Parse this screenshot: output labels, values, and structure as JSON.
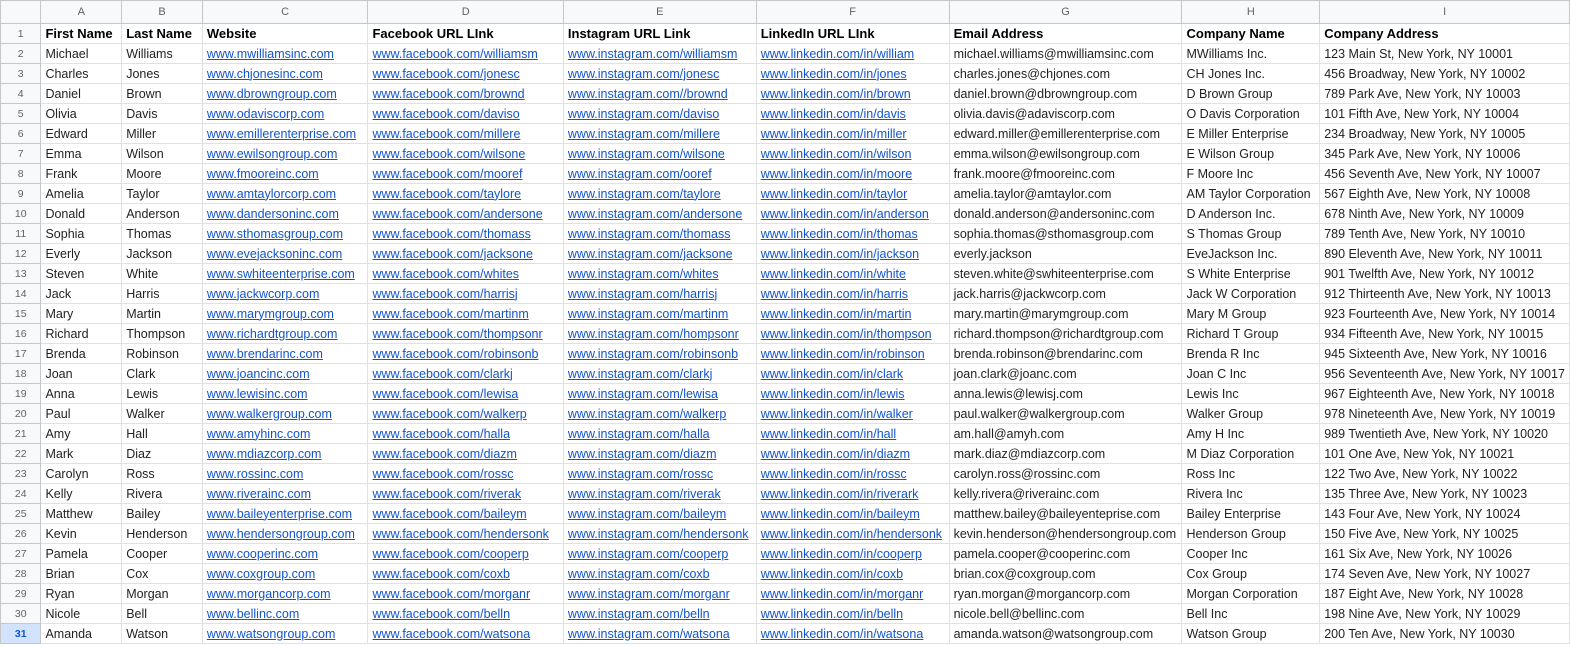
{
  "column_letters": [
    "A",
    "B",
    "C",
    "D",
    "E",
    "F",
    "G",
    "H",
    "I"
  ],
  "header_row": [
    "First Name",
    "Last Name",
    "Website",
    "Facebook URL LInk",
    "Instagram URL Link",
    "LinkedIn URL LInk",
    "Email Address",
    "Company Name",
    "Company Address"
  ],
  "rows": [
    [
      "Michael",
      "Williams",
      "www.mwilliamsinc.com",
      "www.facebook.com/williamsm",
      "www.instagram.com/williamsm",
      "www.linkedin.com/in/william",
      "michael.williams@mwilliamsinc.com",
      "MWilliams Inc.",
      "123 Main St, New York, NY 10001"
    ],
    [
      "Charles",
      "Jones",
      "www.chjonesinc.com",
      "www.facebook.com/jonesc",
      "www.instagram.com/jonesc",
      "www.linkedin.com/in/jones",
      "charles.jones@chjones.com",
      "CH Jones Inc.",
      "456 Broadway, New York, NY 10002"
    ],
    [
      "Daniel",
      "Brown",
      "www.dbrowngroup.com",
      "www.facebook.com/brownd",
      "www.instagram.com//brownd",
      "www.linkedin.com/in/brown",
      "daniel.brown@dbrowngroup.com",
      "D Brown Group",
      "789 Park Ave, New York, NY 10003"
    ],
    [
      "Olivia",
      "Davis",
      "www.odaviscorp.com",
      "www.facebook.com/daviso",
      "www.instagram.com/daviso",
      "www.linkedin.com/in/davis",
      "olivia.davis@adaviscorp.com",
      "O Davis Corporation",
      "101 Fifth Ave, New York, NY 10004"
    ],
    [
      "Edward",
      "Miller",
      "www.emillerenterprise.com",
      "www.facebook.com/millere",
      "www.instagram.com/millere",
      "www.linkedin.com/in/miller",
      "edward.miller@emillerenterprise.com",
      "E Miller Enterprise",
      "234 Broadway, New York, NY 10005"
    ],
    [
      "Emma",
      "Wilson",
      "www.ewilsongroup.com",
      "www.facebook.com/wilsone",
      "www.instagram.com/wilsone",
      "www.linkedin.com/in/wilson",
      "emma.wilson@ewilsongroup.com",
      "E Wilson Group",
      "345 Park Ave, New York, NY 10006"
    ],
    [
      "Frank",
      "Moore",
      "www.fmooreinc.com",
      "www.facebook.com/mooref",
      "www.instagram.com/ooref",
      "www.linkedin.com/in/moore",
      "frank.moore@fmooreinc.com",
      "F Moore Inc",
      "456 Seventh Ave, New York, NY 10007"
    ],
    [
      "Amelia",
      "Taylor",
      "www.amtaylorcorp.com",
      "www.facebook.com/taylore",
      "www.instagram.com/taylore",
      "www.linkedin.com/in/taylor",
      "amelia.taylor@amtaylor.com",
      "AM Taylor Corporation",
      "567 Eighth Ave, New York, NY 10008"
    ],
    [
      "Donald",
      "Anderson",
      "www.dandersoninc.com",
      "www.facebook.com/andersone",
      "www.instagram.com/andersone",
      "www.linkedin.com/in/anderson",
      "donald.anderson@andersoninc.com",
      "D Anderson Inc.",
      "678 Ninth Ave, New York, NY 10009"
    ],
    [
      "Sophia",
      "Thomas",
      "www.sthomasgroup.com",
      "www.facebook.com/thomass",
      "www.instagram.com/thomass",
      "www.linkedin.com/in/thomas",
      "sophia.thomas@sthomasgroup.com",
      "S Thomas  Group",
      "789 Tenth Ave, New York, NY 10010"
    ],
    [
      "Everly",
      "Jackson",
      "www.evejacksoninc.com",
      "www.facebook.com/jacksone",
      "www.instagram.com/jacksone",
      "www.linkedin.com/in/jackson",
      "everly.jackson",
      "EveJackson Inc.",
      "890 Eleventh Ave, New York, NY 10011"
    ],
    [
      "Steven",
      "White",
      "www.swhiteenterprise.com",
      "www.facebook.com/whites",
      "www.instagram.com/whites",
      "www.linkedin.com/in/white",
      "steven.white@swhiteenterprise.com",
      "S White Enterprise",
      "901 Twelfth Ave, New York, NY 10012"
    ],
    [
      "Jack",
      "Harris",
      "www.jackwcorp.com",
      "www.facebook.com/harrisj",
      "www.instagram.com/harrisj",
      "www.linkedin.com/in/harris",
      "jack.harris@jackwcorp.com",
      "Jack W Corporation",
      "912 Thirteenth Ave, New York, NY 10013"
    ],
    [
      "Mary",
      "Martin",
      "www.marymgroup.com",
      "www.facebook.com/martinm",
      "www.instagram.com/martinm",
      "www.linkedin.com/in/martin",
      "mary.martin@marymgroup.com",
      "Mary M Group",
      "923 Fourteenth Ave, New York, NY 10014"
    ],
    [
      "Richard",
      "Thompson",
      "www.richardtgroup.com",
      "www.facebook.com/thompsonr",
      "www.instagram.com/hompsonr",
      "www.linkedin.com/in/thompson",
      "richard.thompson@richardtgroup.com",
      "Richard T Group",
      "934 Fifteenth Ave, New York, NY 10015"
    ],
    [
      "Brenda",
      "Robinson",
      "www.brendarinc.com",
      "www.facebook.com/robinsonb",
      "www.instagram.com/robinsonb",
      "www.linkedin.com/in/robinson",
      "brenda.robinson@brendarinc.com",
      "Brenda R Inc",
      "945 Sixteenth Ave, New York, NY 10016"
    ],
    [
      "Joan",
      "Clark",
      "www.joancinc.com",
      "www.facebook.com/clarkj",
      "www.instagram.com/clarkj",
      "www.linkedin.com/in/clark",
      "joan.clark@joanc.com",
      "Joan C Inc",
      "956 Seventeenth Ave, New York, NY 10017"
    ],
    [
      "Anna",
      "Lewis",
      "www.lewisinc.com",
      "www.facebook.com/lewisa",
      "www.instagram.com/lewisa",
      "www.linkedin.com/in/lewis",
      "anna.lewis@lewisj.com",
      "Lewis Inc",
      "967 Eighteenth Ave, New York, NY 10018"
    ],
    [
      "Paul",
      "Walker",
      "www.walkergroup.com",
      "www.facebook.com/walkerp",
      "www.instagram.com/walkerp",
      "www.linkedin.com/in/walker",
      "paul.walker@walkergroup.com",
      "Walker Group",
      "978 Nineteenth Ave, New York, NY 10019"
    ],
    [
      "Amy",
      "Hall",
      "www.amyhinc.com",
      "www.facebook.com/halla",
      "www.instagram.com/halla",
      "www.linkedin.com/in/hall",
      "am.hall@amyh.com",
      "Amy H Inc",
      "989 Twentieth Ave, New York, NY 10020"
    ],
    [
      "Mark",
      "Diaz",
      "www.mdiazcorp.com",
      "www.facebook.com/diazm",
      "www.instagram.com/diazm",
      "www.linkedin.com/in/diazm",
      "mark.diaz@mdiazcorp.com",
      "M Diaz Corporation",
      "101 One Ave, New Yok, NY 10021"
    ],
    [
      "Carolyn",
      "Ross",
      "www.rossinc.com",
      "www.facebook.com/rossc",
      "www.instagram.com/rossc",
      "www.linkedin.com/in/rossc",
      "carolyn.ross@rossinc.com",
      "Ross Inc",
      "122 Two Ave, New York, NY 10022"
    ],
    [
      "Kelly",
      "Rivera",
      "www.riverainc.com",
      "www.facebook.com/riverak",
      "www.instagram.com/riverak",
      "www.linkedin.com/in/riverark",
      "kelly.rivera@riverainc.com",
      "Rivera Inc",
      "135 Three Ave, New York, NY 10023"
    ],
    [
      "Matthew",
      "Bailey",
      "www.baileyenterprise.com",
      "www.facebook.com/baileym",
      "www.instagram.com/baileym",
      "www.linkedin.com/in/baileym",
      "matthew.bailey@baileyenteprise.com",
      "Bailey Enterprise",
      "143 Four Ave, New York, NY 10024"
    ],
    [
      "Kevin",
      "Henderson",
      "www.hendersongroup.com",
      "www.facebook.com/hendersonk",
      "www.instagram.com/hendersonk",
      "www.linkedin.com/in/hendersonk",
      "kevin.henderson@hendersongroup.com",
      "Henderson Group",
      "150 Five Ave, New York, NY 10025"
    ],
    [
      "Pamela",
      "Cooper",
      "www.cooperinc.com",
      "www.facebook.com/cooperp",
      "www.instagram.com/cooperp",
      "www.linkedin.com/in/cooperp",
      "pamela.cooper@cooperinc.com",
      "Cooper Inc",
      "161 Six Ave, New York, NY 10026"
    ],
    [
      "Brian",
      "Cox",
      "www.coxgroup.com",
      "www.facebook.com/coxb",
      "www.instagram.com/coxb",
      "www.linkedin.com/in/coxb",
      "brian.cox@coxgroup.com",
      "Cox Group",
      "174 Seven Ave, New York, NY 10027"
    ],
    [
      "Ryan",
      "Morgan",
      "www.morgancorp.com",
      "www.facebook.com/morganr",
      "www.instagram.com/morganr",
      "www.linkedin.com/in/morganr",
      "ryan.morgan@morgancorp.com",
      "Morgan Corporation",
      "187 Eight Ave, New York, NY 10028"
    ],
    [
      "Nicole",
      "Bell",
      "www.bellinc.com",
      "www.facebook.com/belln",
      "www.instagram.com/belln",
      "www.linkedin.com/in/belln",
      "nicole.bell@bellinc.com",
      "Bell Inc",
      "198 Nine Ave, New York, NY 10029"
    ],
    [
      "Amanda",
      "Watson",
      "www.watsongroup.com",
      "www.facebook.com/watsona",
      "www.instagram.com/watsona",
      "www.linkedin.com/in/watsona",
      "amanda.watson@watsongroup.com",
      "Watson Group",
      "200 Ten Ave, New York, NY 10030"
    ]
  ],
  "colors": {
    "link": "#1155cc",
    "header_bg": "#f8f9fa",
    "active_row": "#d3e3fd",
    "grid": "#e1e1e1"
  }
}
